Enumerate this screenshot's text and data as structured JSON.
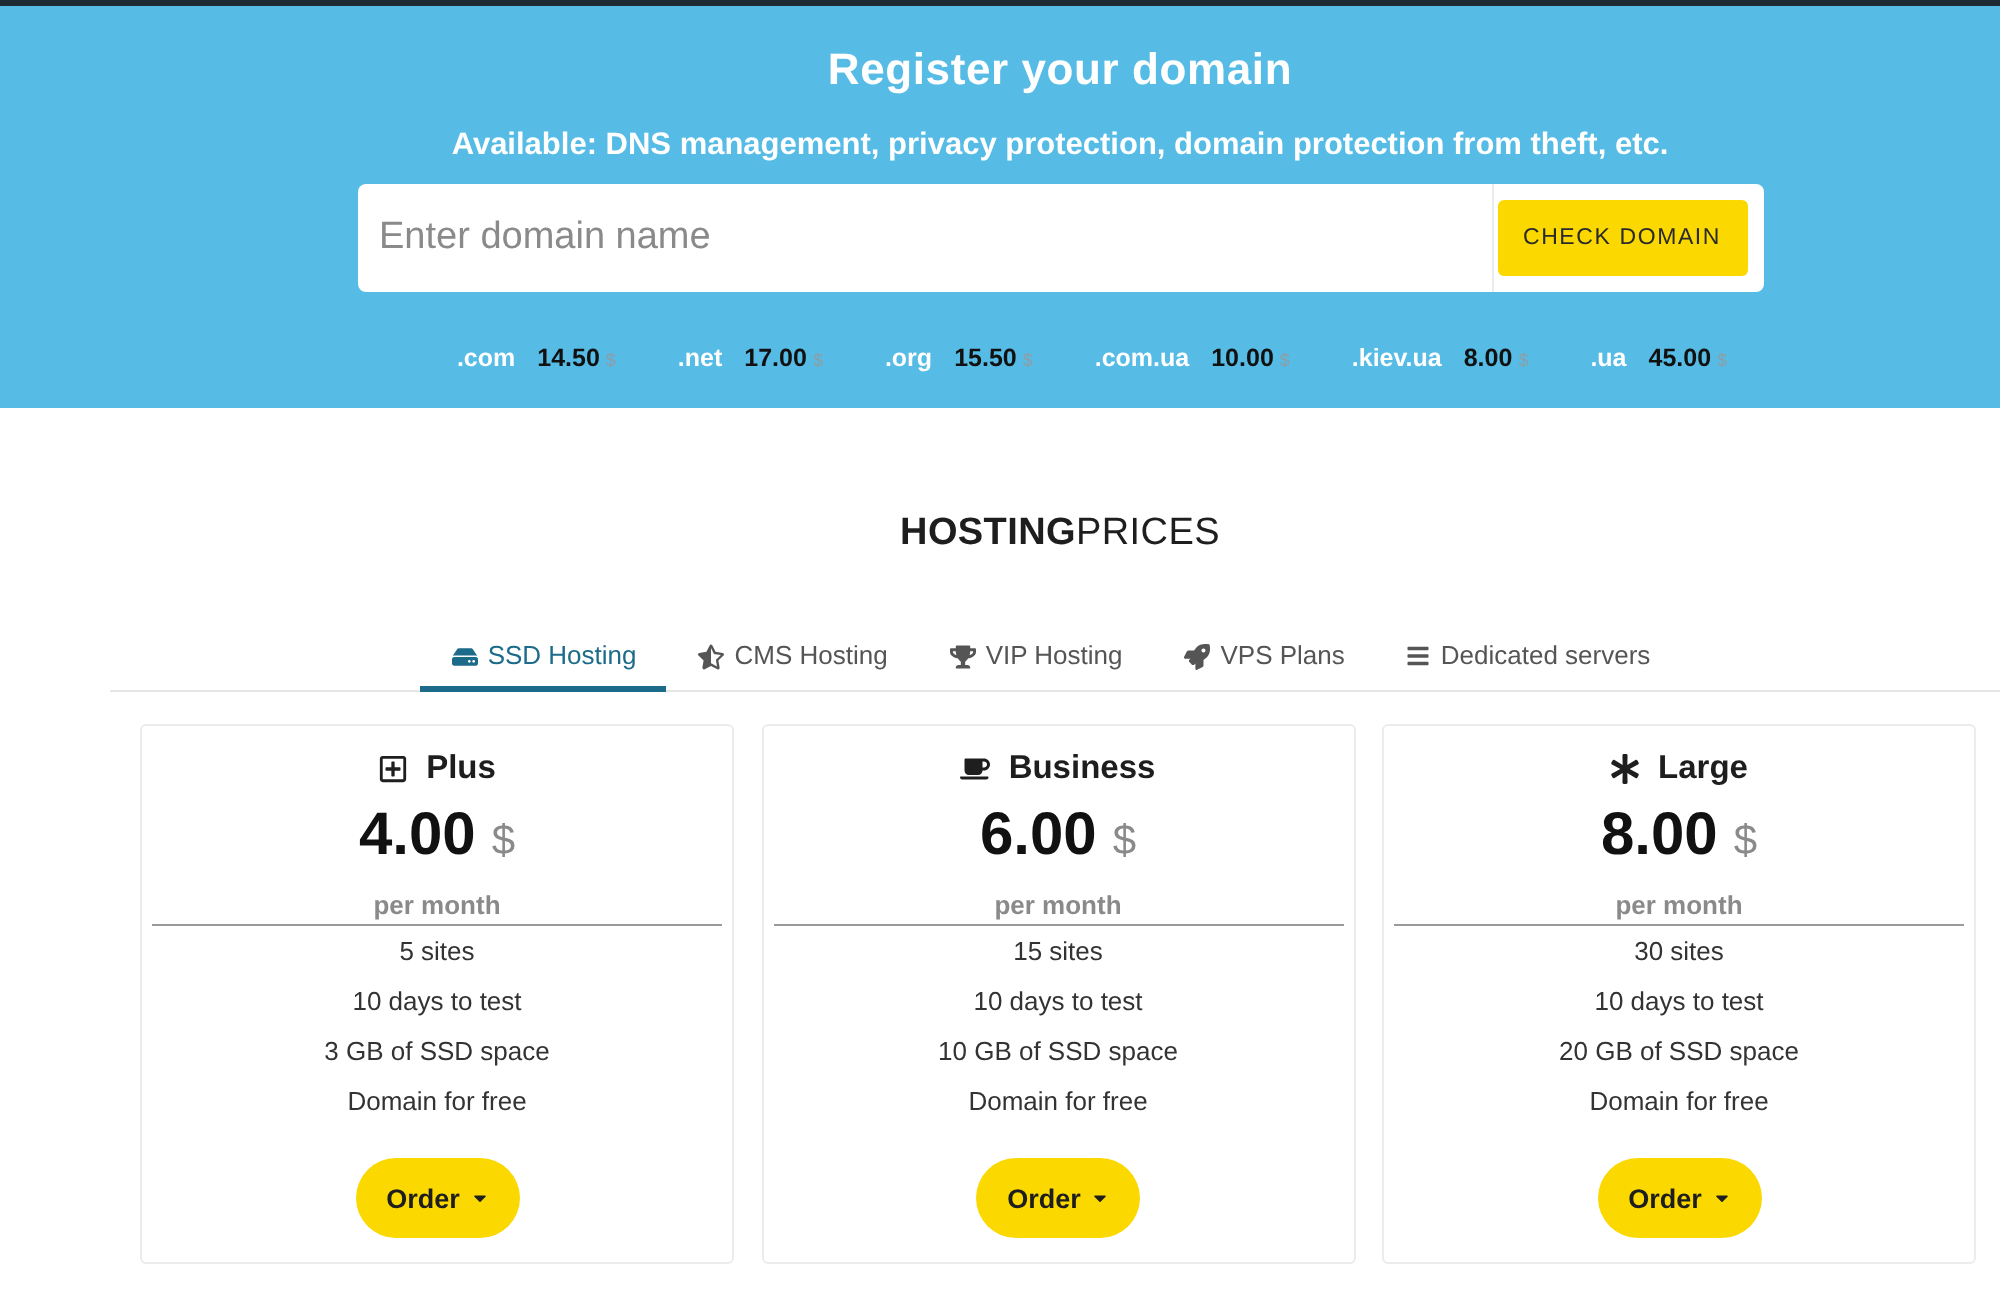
{
  "domain_search": {
    "title": "Register your domain",
    "subtitle": "Available: DNS management, privacy protection, domain protection from theft, etc.",
    "placeholder": "Enter domain name",
    "button": "CHECK DOMAIN"
  },
  "domain_prices": [
    {
      "zone": ".com",
      "price": "14.50",
      "currency": "$"
    },
    {
      "zone": ".net",
      "price": "17.00",
      "currency": "$"
    },
    {
      "zone": ".org",
      "price": "15.50",
      "currency": "$"
    },
    {
      "zone": ".com.ua",
      "price": "10.00",
      "currency": "$"
    },
    {
      "zone": ".kiev.ua",
      "price": "8.00",
      "currency": "$"
    },
    {
      "zone": ".ua",
      "price": "45.00",
      "currency": "$"
    }
  ],
  "hosting": {
    "heading": "**HOSTING**PRICES"
  },
  "tabs": [
    {
      "label": "SSD Hosting",
      "selected": true
    },
    {
      "label": "CMS Hosting",
      "selected": false
    },
    {
      "label": "VIP Hosting",
      "selected": false
    },
    {
      "label": "VPS Plans",
      "selected": false
    },
    {
      "label": "Dedicated servers",
      "selected": false
    }
  ],
  "plans": [
    {
      "name": "Plus",
      "price": "4.00",
      "currency": "$",
      "period": "per month",
      "features": [
        "5 sites",
        "10 days to test",
        "3 GB of SSD space",
        "Domain for free"
      ],
      "button": "Order"
    },
    {
      "name": "Business",
      "price": "6.00",
      "currency": "$",
      "period": "per month",
      "features": [
        "15 sites",
        "10 days to test",
        "10 GB of SSD space",
        "Domain for free"
      ],
      "button": "Order"
    },
    {
      "name": "Large",
      "price": "8.00",
      "currency": "$",
      "period": "per month",
      "features": [
        "30 sites",
        "10 days to test",
        "20 GB of SSD space",
        "Domain for free"
      ],
      "button": "Order"
    }
  ]
}
